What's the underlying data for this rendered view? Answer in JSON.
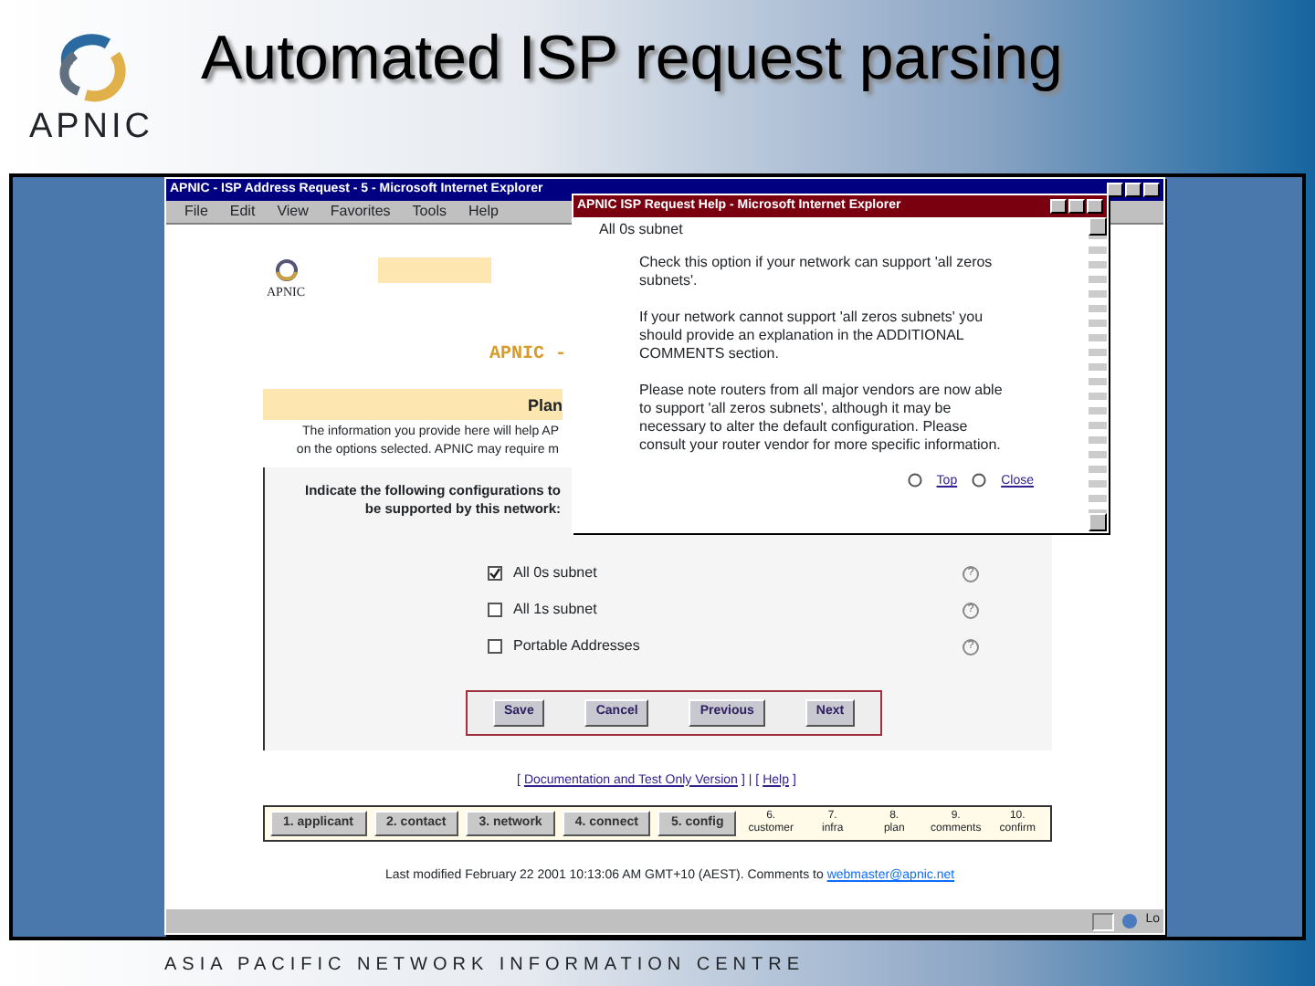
{
  "slide": {
    "title": "Automated ISP request parsing",
    "logo_text": "APNIC",
    "footer": "ASIA PACIFIC NETWORK INFORMATION CENTRE"
  },
  "browser": {
    "title": "APNIC - ISP Address Request - 5 - Microsoft Internet Explorer",
    "menu": [
      "File",
      "Edit",
      "View",
      "Favorites",
      "Tools",
      "Help"
    ],
    "status": "Lo"
  },
  "page": {
    "logo_text": "APNIC",
    "heading": "APNIC -",
    "band": "Plan",
    "intro": [
      "The information you provide here will help AP",
      "on the options selected. APNIC may require m"
    ],
    "instruction": [
      "Indicate the following configurations to",
      "be supported by this network:"
    ],
    "options": [
      {
        "label": "All 0s subnet",
        "checked": true,
        "help": "?"
      },
      {
        "label": "All 1s subnet",
        "checked": false,
        "help": "?"
      },
      {
        "label": "Portable Addresses",
        "checked": false,
        "help": "?"
      }
    ],
    "buttons": [
      "Save",
      "Cancel",
      "Previous",
      "Next"
    ],
    "link_row": [
      {
        "kind": "text",
        "text": "["
      },
      {
        "kind": "link",
        "text": "Documentation and Test Only Version"
      },
      {
        "kind": "text",
        "text": "] | ["
      },
      {
        "kind": "link",
        "text": "Help"
      },
      {
        "kind": "text",
        "text": "]"
      }
    ],
    "steps": [
      {
        "kind": "button",
        "number": "1.",
        "name": "applicant"
      },
      {
        "kind": "button",
        "number": "2.",
        "name": "contact"
      },
      {
        "kind": "button",
        "number": "3.",
        "name": "network"
      },
      {
        "kind": "button",
        "number": "4.",
        "name": "connect"
      },
      {
        "kind": "button",
        "number": "5.",
        "name": "config"
      },
      {
        "kind": "text",
        "number": "6.",
        "name": "customer"
      },
      {
        "kind": "text",
        "number": "7.",
        "name": "infra"
      },
      {
        "kind": "text",
        "number": "8.",
        "name": "plan"
      },
      {
        "kind": "text",
        "number": "9.",
        "name": "comments"
      },
      {
        "kind": "text",
        "number": "10.",
        "name": "confirm"
      }
    ],
    "footer": "Last modified February 22 2001 10:13:06 AM GMT+10 (AEST). Comments to ",
    "footer_link": "webmaster@apnic.net"
  },
  "popup": {
    "title": "APNIC ISP Request Help - Microsoft Internet Explorer",
    "heading": "All 0s subnet",
    "paragraphs": [
      "Check this option if your network can support 'all zeros subnets'.",
      "If your network cannot support 'all zeros subnets' you should provide an explanation in the ADDITIONAL COMMENTS section.",
      "Please note routers from all major vendors are now able to support 'all zeros subnets', although it may be necessary to alter the default configuration. Please consult your router vendor for more specific information."
    ],
    "links": [
      "Top",
      "Close"
    ]
  }
}
